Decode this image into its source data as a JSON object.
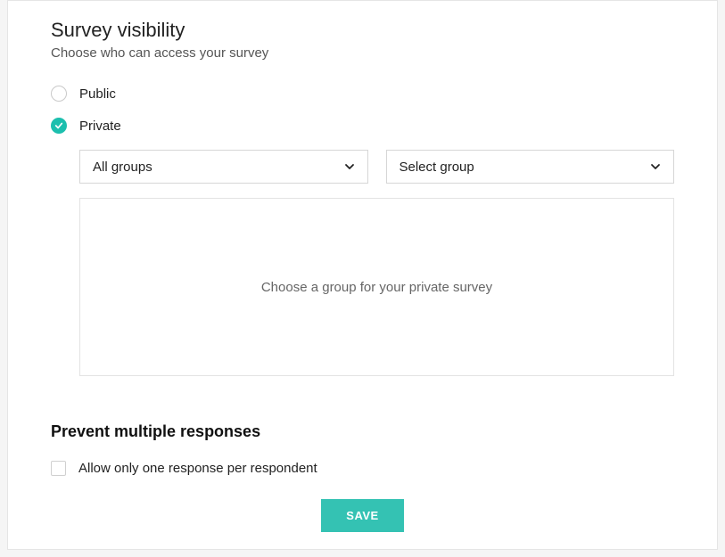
{
  "visibility": {
    "title": "Survey visibility",
    "subtitle": "Choose who can access your survey",
    "options": {
      "public": "Public",
      "private": "Private"
    },
    "selected": "private",
    "group_type_select": "All groups",
    "group_select": "Select group",
    "empty_message": "Choose a group for your private survey"
  },
  "prevent": {
    "title": "Prevent multiple responses",
    "checkbox_label": "Allow only one response per respondent",
    "checked": false
  },
  "actions": {
    "save": "SAVE"
  }
}
